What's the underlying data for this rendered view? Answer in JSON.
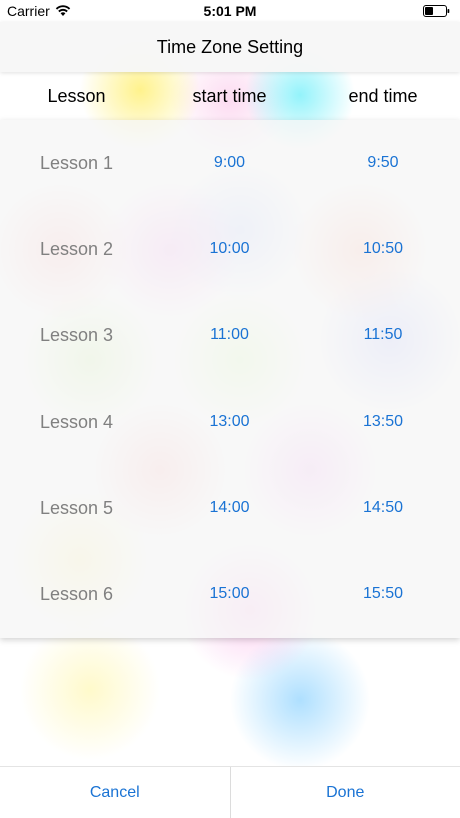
{
  "status_bar": {
    "carrier": "Carrier",
    "time": "5:01 PM",
    "wifi_icon": "wifi-icon",
    "battery_icon": "battery-icon"
  },
  "nav": {
    "title": "Time Zone Setting"
  },
  "table": {
    "headers": [
      "Lesson",
      "start time",
      "end time"
    ],
    "rows": [
      {
        "lesson": "Lesson 1",
        "start": "9:00",
        "end": "9:50"
      },
      {
        "lesson": "Lesson 2",
        "start": "10:00",
        "end": "10:50"
      },
      {
        "lesson": "Lesson 3",
        "start": "11:00",
        "end": "11:50"
      },
      {
        "lesson": "Lesson 4",
        "start": "13:00",
        "end": "13:50"
      },
      {
        "lesson": "Lesson 5",
        "start": "14:00",
        "end": "14:50"
      },
      {
        "lesson": "Lesson 6",
        "start": "15:00",
        "end": "15:50"
      }
    ]
  },
  "actions": {
    "cancel": "Cancel",
    "done": "Done"
  },
  "colors": {
    "accent": "#1a73d4",
    "lesson_text": "#808080"
  }
}
